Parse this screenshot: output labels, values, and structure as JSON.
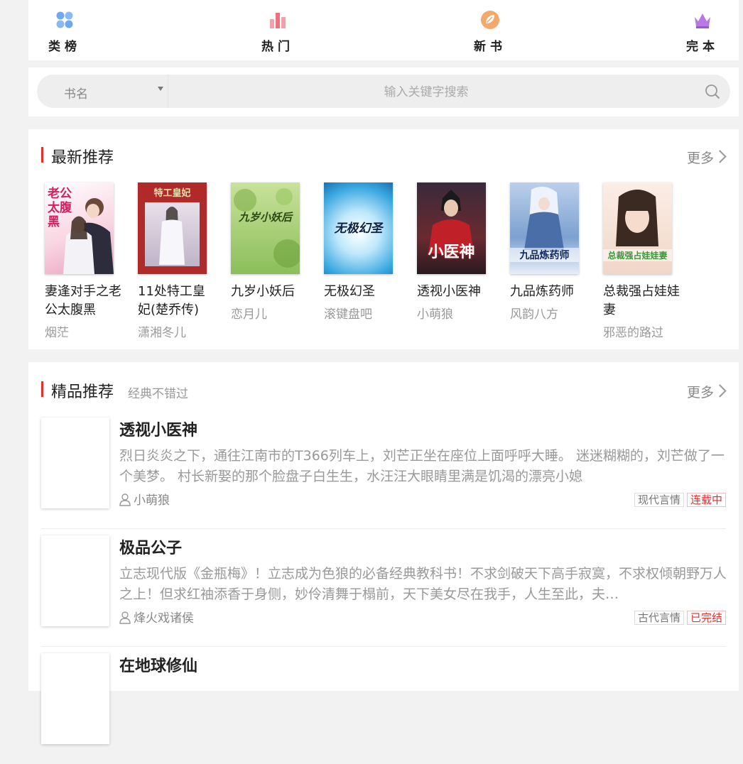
{
  "nav": {
    "items": [
      {
        "label": "类榜",
        "icon": "category-dots-icon",
        "color": "#6fa8f0"
      },
      {
        "label": "热门",
        "icon": "bar-chart-icon",
        "color": "#f08090"
      },
      {
        "label": "新书",
        "icon": "leaf-circle-icon",
        "color": "#f0a060"
      },
      {
        "label": "完本",
        "icon": "crown-icon",
        "color": "#b070e0"
      }
    ]
  },
  "search": {
    "type_label": "书名",
    "placeholder": "输入关键字搜索"
  },
  "latest": {
    "title": "最新推荐",
    "more": "更多",
    "books": [
      {
        "title": "妻逢对手之老公太腹黑",
        "author": "烟茫",
        "cover_text": "老公太腹黑",
        "bg": "#fbe8ef",
        "fg": "#d02060"
      },
      {
        "title": "11处特工皇妃(楚乔传)",
        "author": "潇湘冬儿",
        "cover_text": "特工皇妃",
        "bg": "#b02a2a",
        "fg": "#f3e0b0"
      },
      {
        "title": "九岁小妖后",
        "author": "恋月儿",
        "cover_text": "九岁小妖后",
        "bg": "#a8d07a",
        "fg": "#2a4a10"
      },
      {
        "title": "无极幻圣",
        "author": "滚键盘吧",
        "cover_text": "无极幻圣",
        "bg": "#6cc8ee",
        "fg": "#102040"
      },
      {
        "title": "透视小医神",
        "author": "小萌狼",
        "cover_text": "小医神",
        "bg": "#4a2030",
        "fg": "#ffffff"
      },
      {
        "title": "九品炼药师",
        "author": "风韵八方",
        "cover_text": "九品炼药师",
        "bg": "#8fb2dc",
        "fg": "#102a60"
      },
      {
        "title": "总裁强占娃娃妻",
        "author": "邪恶的路过",
        "cover_text": "总裁强占娃娃妻",
        "bg": "#f6e2d8",
        "fg": "#3a9a3a"
      }
    ]
  },
  "quality": {
    "title": "精品推荐",
    "subtitle": "经典不错过",
    "more": "更多",
    "items": [
      {
        "title": "透视小医神",
        "desc": "烈日炎炎之下，通往江南市的T366列车上，刘芒正坐在座位上面呼呼大睡。 迷迷糊糊的，刘芒做了一个美梦。 村长新娶的那个脸盘子白生生，水汪汪大眼睛里满是饥渴的漂亮小媳",
        "author": "小萌狼",
        "genre": "现代言情",
        "status": "连载中"
      },
      {
        "title": "极品公子",
        "desc": "立志现代版《金瓶梅》！立志成为色狼的必备经典教科书！不求剑破天下高手寂寞，不求权倾朝野万人之上！但求红袖添香于身侧，妙伶清舞于榻前，天下美女尽在我手，人生至此，夫…",
        "author": "烽火戏诸侯",
        "genre": "古代言情",
        "status": "已完结"
      },
      {
        "title": "在地球修仙",
        "desc": "",
        "author": "",
        "genre": "",
        "status": ""
      }
    ]
  }
}
